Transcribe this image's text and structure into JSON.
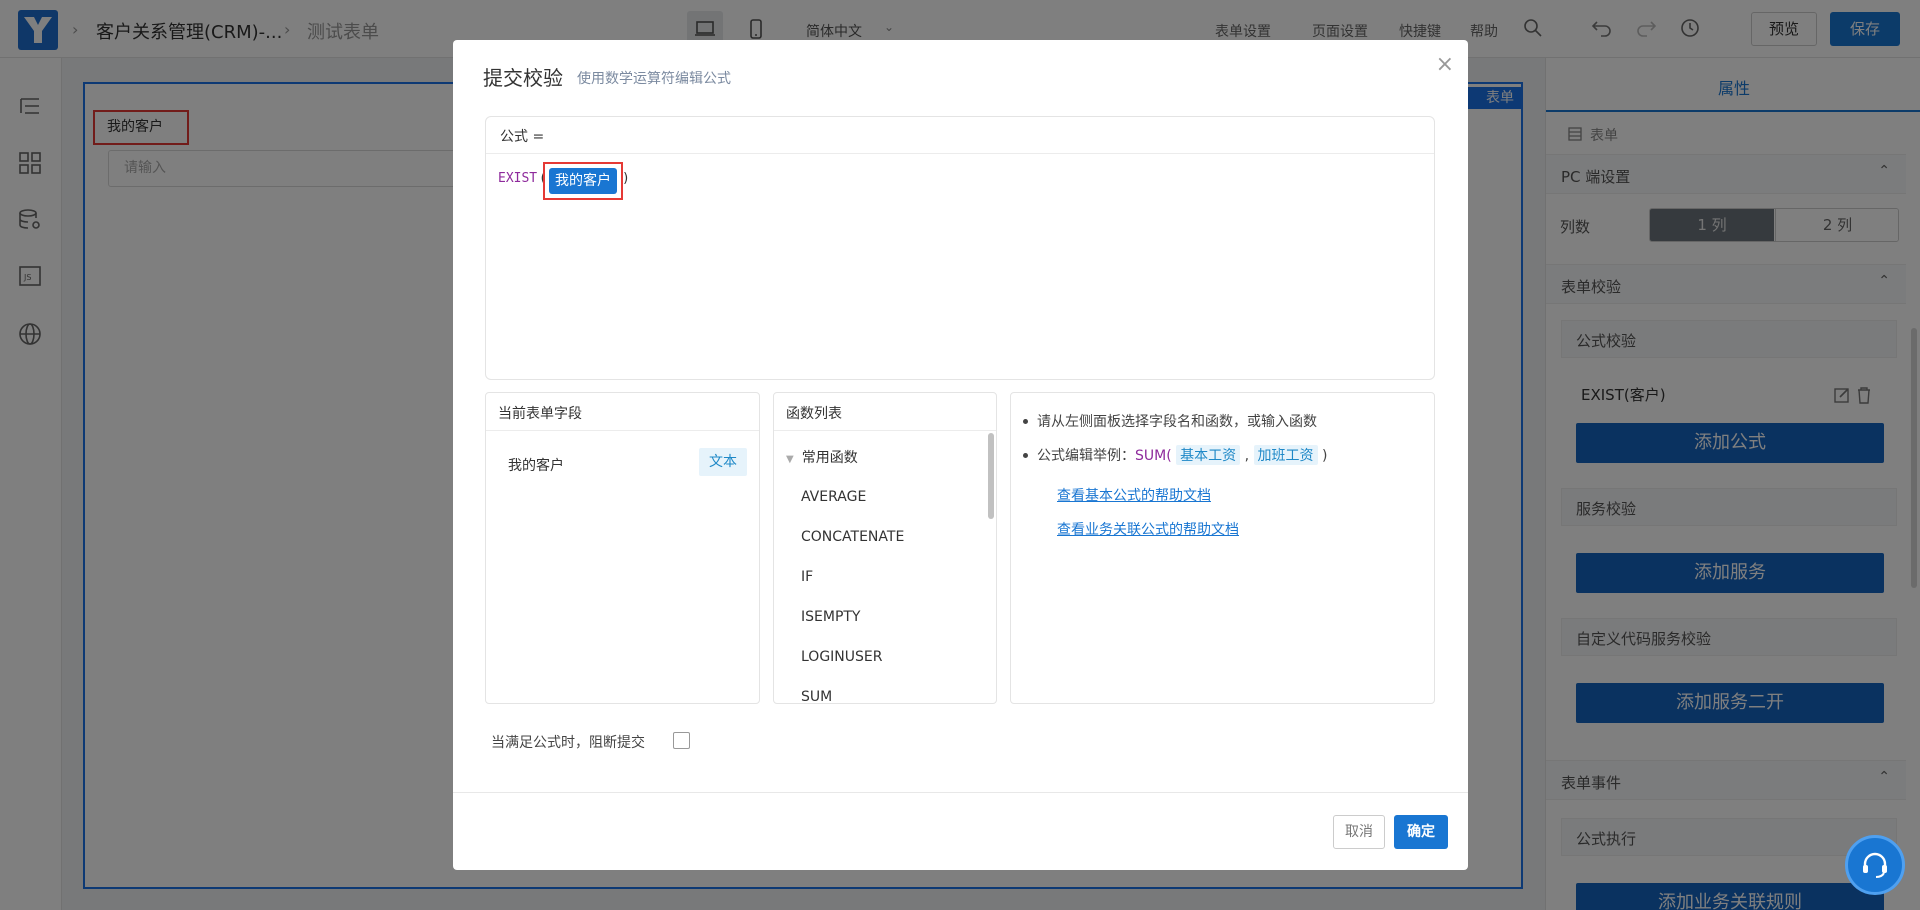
{
  "header": {
    "app_name": "客户关系管理(CRM)-...",
    "page_name": "测试表单",
    "language": "简体中文",
    "links": [
      "表单设置",
      "页面设置",
      "快捷键",
      "帮助"
    ],
    "preview_label": "预览",
    "save_label": "保存"
  },
  "canvas": {
    "tag": "表单",
    "field_label": "我的客户",
    "field_placeholder": "请输入"
  },
  "right_panel": {
    "tab": "属性",
    "form_label": "表单",
    "pc_settings": "PC 端设置",
    "columns_label": "列数",
    "col1": "1 列",
    "col2": "2 列",
    "form_validation": "表单校验",
    "formula_validation": "公式校验",
    "formula_item": "EXIST(客户)",
    "add_formula": "添加公式",
    "service_validation": "服务校验",
    "add_service": "添加服务",
    "custom_code_validation": "自定义代码服务校验",
    "add_service_dev": "添加服务二开",
    "form_events": "表单事件",
    "formula_exec": "公式执行",
    "add_rule": "添加业务关联规则"
  },
  "dialog": {
    "title": "提交校验",
    "subtitle": "使用数学运算符编辑公式",
    "formula_header": "公式 =",
    "formula_fn": "EXIST",
    "formula_field_token": "我的客户",
    "fields_panel_title": "当前表单字段",
    "field_name": "我的客户",
    "field_type": "文本",
    "functions_panel_title": "函数列表",
    "function_group": "常用函数",
    "functions": [
      "AVERAGE",
      "CONCATENATE",
      "IF",
      "ISEMPTY",
      "LOGINUSER",
      "SUM"
    ],
    "help_line1": "请从左侧面板选择字段名和函数，或输入函数",
    "help_line2_prefix": "公式编辑举例：",
    "help_example_fn": "SUM",
    "help_example_arg1": "基本工资",
    "help_example_arg2": "加班工资",
    "help_link1": "查看基本公式的帮助文档",
    "help_link2": "查看业务关联公式的帮助文档",
    "block_label": "当满足公式时，阻断提交",
    "cancel_label": "取消",
    "ok_label": "确定"
  }
}
